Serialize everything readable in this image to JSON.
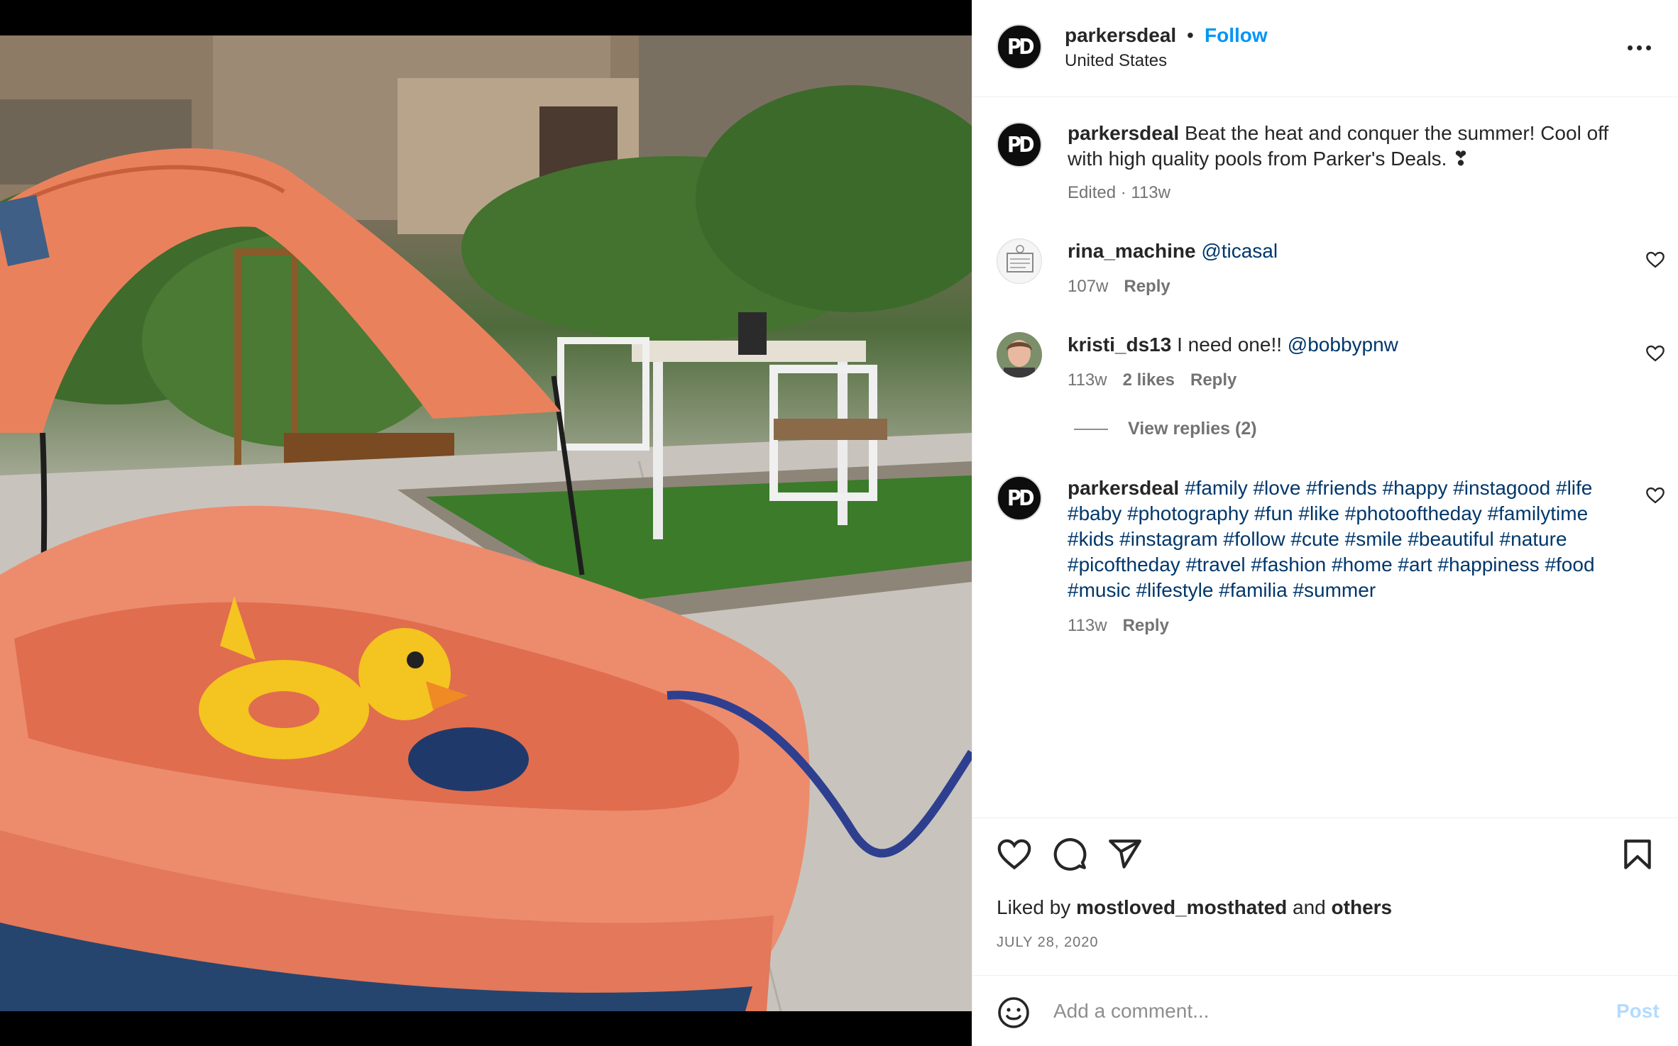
{
  "post_author": {
    "username": "parkersdeal",
    "separator": "•",
    "follow_label": "Follow",
    "location": "United States",
    "avatar_text": "PD"
  },
  "caption": {
    "username": "parkersdeal",
    "text": "Beat the heat and conquer the summer! Cool off with high quality pools from Parker's Deals. ❣",
    "meta": "Edited · 113w"
  },
  "comments": [
    {
      "username": "rina_machine",
      "mention": "@ticasal",
      "time": "107w",
      "reply_label": "Reply"
    },
    {
      "username": "kristi_ds13",
      "text": "I need one!!",
      "mention": "@bobbypnw",
      "time": "113w",
      "likes": "2 likes",
      "reply_label": "Reply",
      "view_replies": "View replies (2)"
    },
    {
      "username": "parkersdeal",
      "hashtags": "#family #love #friends #happy #instagood #life #baby #photography #fun #like #photooftheday #familytime #kids #instagram #follow #cute #smile #beautiful #nature #picoftheday #travel #fashion #home #art #happiness #food #music #lifestyle #familia #summer",
      "time": "113w",
      "reply_label": "Reply"
    }
  ],
  "likes": {
    "prefix": "Liked by",
    "user": "mostloved_mosthated",
    "conjunction": "and",
    "others": "others"
  },
  "date": "JULY 28, 2020",
  "comment_box": {
    "placeholder": "Add a comment...",
    "post_label": "Post"
  },
  "icons": [
    "more-options-icon",
    "heart-icon",
    "comment-icon",
    "share-icon",
    "bookmark-icon",
    "smile-icon"
  ],
  "colors": {
    "follow": "#0095f6",
    "mention": "#00376b",
    "muted": "#737373",
    "post_disabled": "#b3dbff"
  }
}
